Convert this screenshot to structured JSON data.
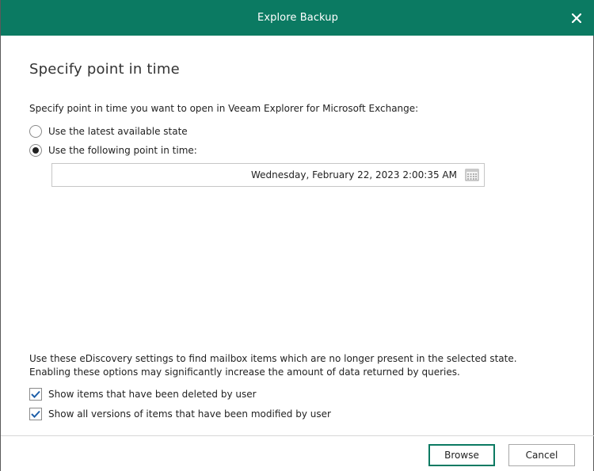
{
  "window": {
    "title": "Explore Backup",
    "close_icon": "close-icon"
  },
  "page": {
    "heading": "Specify point in time",
    "prompt": "Specify point in time you want to open in Veeam Explorer for Microsoft Exchange:"
  },
  "options": {
    "latest_label": "Use the latest available state",
    "latest_selected": false,
    "point_label": "Use the following point in time:",
    "point_selected": true
  },
  "datetime": {
    "value": "Wednesday, February 22, 2023 2:00:35 AM",
    "icon": "calendar-icon"
  },
  "ediscovery": {
    "note_line1": "Use these eDiscovery settings to find mailbox items which are no longer present in the selected state.",
    "note_line2": "Enabling these options may significantly increase the amount of data returned by queries.",
    "deleted_label": "Show items that have been deleted by user",
    "deleted_checked": true,
    "versions_label": "Show all versions of items that have been modified by user",
    "versions_checked": true
  },
  "footer": {
    "browse_label": "Browse",
    "cancel_label": "Cancel"
  },
  "colors": {
    "titlebar": "#0b7a62",
    "check_mark": "#1f5fa8"
  }
}
